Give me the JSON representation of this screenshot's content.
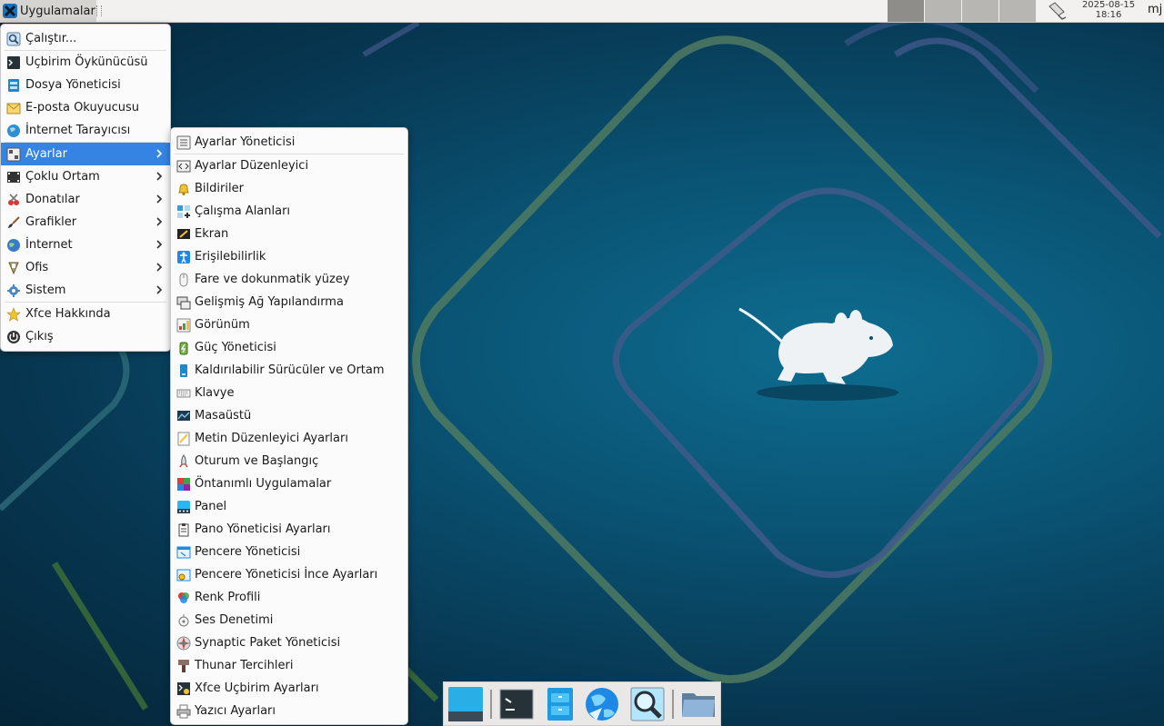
{
  "top_panel": {
    "apps_label": "Uygulamalar",
    "clock_date": "2025-08-15",
    "clock_time": "18:16",
    "user": "mj"
  },
  "main_menu": {
    "items": [
      {
        "label": "Çalıştır...",
        "icon": "run-icon"
      },
      {
        "label": "Uçbirim Öykünücüsü",
        "icon": "terminal-icon"
      },
      {
        "label": "Dosya Yöneticisi",
        "icon": "file-manager-icon"
      },
      {
        "label": "E-posta Okuyucusu",
        "icon": "mail-icon"
      },
      {
        "label": "İnternet Tarayıcısı",
        "icon": "web-browser-icon"
      },
      {
        "label": "Ayarlar",
        "icon": "settings-icon",
        "submenu": true,
        "selected": true
      },
      {
        "label": "Çoklu Ortam",
        "icon": "multimedia-icon",
        "submenu": true
      },
      {
        "label": "Donatılar",
        "icon": "accessories-icon",
        "submenu": true
      },
      {
        "label": "Grafikler",
        "icon": "graphics-icon",
        "submenu": true
      },
      {
        "label": "İnternet",
        "icon": "internet-icon",
        "submenu": true
      },
      {
        "label": "Ofis",
        "icon": "office-icon",
        "submenu": true
      },
      {
        "label": "Sistem",
        "icon": "system-icon",
        "submenu": true
      },
      {
        "label": "Xfce Hakkında",
        "icon": "star-icon"
      },
      {
        "label": "Çıkış",
        "icon": "logout-icon"
      }
    ]
  },
  "settings_menu": {
    "items": [
      {
        "label": "Ayarlar Yöneticisi",
        "icon": "settings-manager-icon"
      },
      {
        "label": "Ayarlar Düzenleyici",
        "icon": "settings-editor-icon"
      },
      {
        "label": "Bildiriler",
        "icon": "notifications-bell-icon"
      },
      {
        "label": "Çalışma Alanları",
        "icon": "workspaces-icon"
      },
      {
        "label": "Ekran",
        "icon": "display-icon"
      },
      {
        "label": "Erişilebilirlik",
        "icon": "accessibility-icon"
      },
      {
        "label": "Fare ve dokunmatik yüzey",
        "icon": "mouse-icon"
      },
      {
        "label": "Gelişmiş Ağ Yapılandırma",
        "icon": "network-icon"
      },
      {
        "label": "Görünüm",
        "icon": "appearance-icon"
      },
      {
        "label": "Güç Yöneticisi",
        "icon": "power-manager-icon"
      },
      {
        "label": "Kaldırılabilir Sürücüler ve Ortam",
        "icon": "removable-drive-icon"
      },
      {
        "label": "Klavye",
        "icon": "keyboard-icon"
      },
      {
        "label": "Masaüstü",
        "icon": "desktop-icon"
      },
      {
        "label": "Metin Düzenleyici Ayarları",
        "icon": "text-editor-icon"
      },
      {
        "label": "Oturum ve Başlangıç",
        "icon": "rocket-icon"
      },
      {
        "label": "Öntanımlı Uygulamalar",
        "icon": "default-apps-icon"
      },
      {
        "label": "Panel",
        "icon": "panel-icon"
      },
      {
        "label": "Pano Yöneticisi Ayarları",
        "icon": "clipboard-icon"
      },
      {
        "label": "Pencere Yöneticisi",
        "icon": "window-manager-icon"
      },
      {
        "label": "Pencere Yöneticisi İnce Ayarları",
        "icon": "window-tweaks-icon"
      },
      {
        "label": "Renk Profili",
        "icon": "color-profile-icon"
      },
      {
        "label": "Ses Denetimi",
        "icon": "volume-icon"
      },
      {
        "label": "Synaptic Paket Yöneticisi",
        "icon": "synaptic-icon"
      },
      {
        "label": "Thunar Tercihleri",
        "icon": "thunar-prefs-icon"
      },
      {
        "label": "Xfce Uçbirim Ayarları",
        "icon": "terminal-settings-icon"
      },
      {
        "label": "Yazıcı Ayarları",
        "icon": "printer-icon"
      }
    ]
  },
  "dock": {
    "items": [
      {
        "icon": "show-desktop-icon"
      },
      {
        "icon": "terminal-icon"
      },
      {
        "icon": "file-manager-icon"
      },
      {
        "icon": "web-browser-icon"
      },
      {
        "icon": "app-finder-icon"
      },
      {
        "icon": "folder-icon"
      }
    ]
  },
  "colors": {
    "accent": "#3584e4",
    "desktop_bg": "#0a5576"
  }
}
